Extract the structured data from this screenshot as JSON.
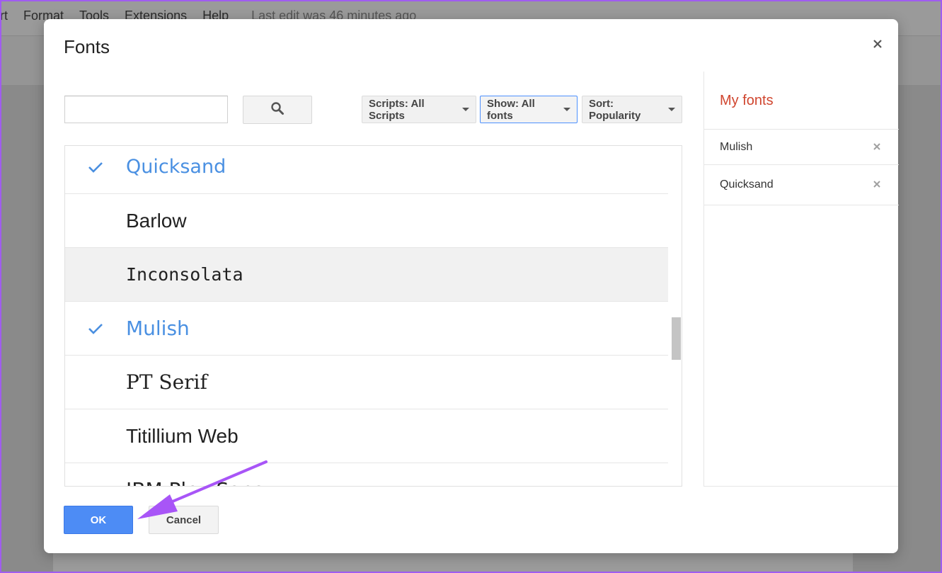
{
  "background": {
    "menu_items": [
      "rt",
      "Format",
      "Tools",
      "Extensions",
      "Help"
    ],
    "last_edit": "Last edit was 46 minutes ago"
  },
  "dialog": {
    "title": "Fonts",
    "close_icon": "close-icon"
  },
  "search": {
    "value": "",
    "placeholder": "",
    "button_icon": "search-icon"
  },
  "filters": {
    "scripts_label": "Scripts: All Scripts",
    "show_label": "Show: All fonts",
    "sort_label": "Sort: Popularity"
  },
  "font_list": [
    {
      "name": "Quicksand",
      "selected": true
    },
    {
      "name": "Barlow",
      "selected": false
    },
    {
      "name": "Inconsolata",
      "selected": false
    },
    {
      "name": "Mulish",
      "selected": true
    },
    {
      "name": "PT Serif",
      "selected": false
    },
    {
      "name": "Titillium Web",
      "selected": false
    },
    {
      "name": "IBM Plex Sans",
      "selected": false
    }
  ],
  "my_fonts": {
    "title": "My fonts",
    "items": [
      "Mulish",
      "Quicksand"
    ]
  },
  "footer": {
    "ok_label": "OK",
    "cancel_label": "Cancel"
  },
  "colors": {
    "accent_blue": "#4d8cf5",
    "selected_font": "#4a90e2",
    "my_fonts_title": "#d0462f",
    "annotation_arrow": "#a855f7"
  }
}
